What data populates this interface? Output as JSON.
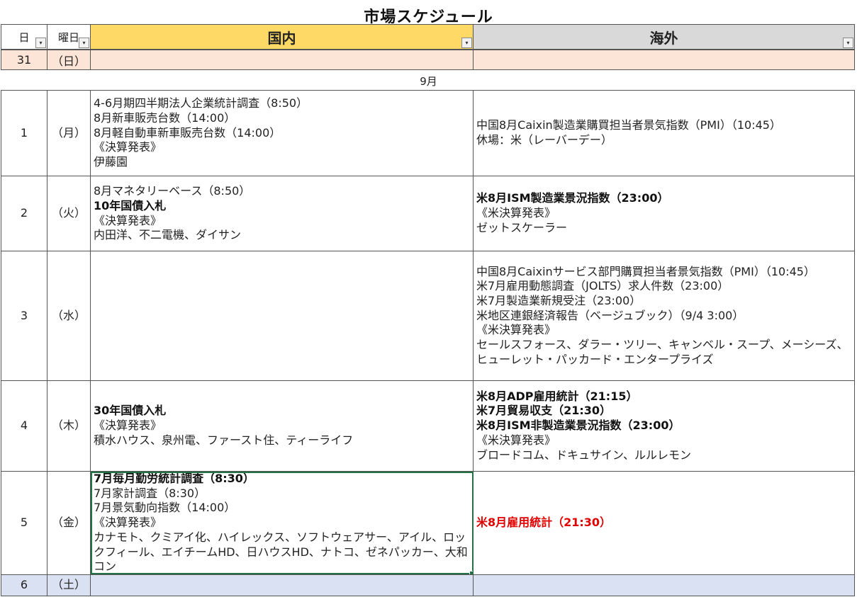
{
  "title": "市場スケジュール",
  "header": {
    "day": "日",
    "weekday": "曜日",
    "domestic": "国内",
    "overseas": "海外",
    "filter_glyph": "▾"
  },
  "row31": {
    "day": "31",
    "weekday": "（日）",
    "domestic": "",
    "overseas": ""
  },
  "month_label": "9月",
  "rows": [
    {
      "day": "1",
      "weekday": "（月）",
      "domestic": [
        "4-6月期四半期法人企業統計調査（8:50）",
        "8月新車販売台数（14:00）",
        "8月軽自動車新車販売台数（14:00）",
        "《決算発表》",
        "伊藤園"
      ],
      "overseas": [
        "中国8月Caixin製造業購買担当者景気指数（PMI）（10:45）",
        "休場：米（レーバーデー）"
      ]
    },
    {
      "day": "2",
      "weekday": "（火）",
      "domestic": [
        "8月マネタリーベース（8:50）",
        "10年国債入札",
        "《決算発表》",
        "内田洋、不二電機、ダイサン"
      ],
      "overseas": [
        "米8月ISM製造業景況指数（23:00）",
        "《米決算発表》",
        "ゼットスケーラー"
      ]
    },
    {
      "day": "3",
      "weekday": "（水）",
      "domestic": [],
      "overseas": [
        "中国8月Caixinサービス部門購買担当者景気指数（PMI）（10:45）",
        "米7月雇用動態調査（JOLTS）求人件数（23:00）",
        "米7月製造業新規受注（23:00）",
        "米地区連銀経済報告（ベージュブック）（9/4 3:00）",
        "《米決算発表》",
        "セールスフォース、ダラー・ツリー、キャンベル・スープ、メーシーズ、ヒューレット・パッカード・エンタープライズ"
      ]
    },
    {
      "day": "4",
      "weekday": "（木）",
      "domestic": [
        "30年国債入札",
        "《決算発表》",
        "積水ハウス、泉州電、ファースト住、ティーライフ"
      ],
      "overseas": [
        "米8月ADP雇用統計（21:15）",
        "米7月貿易収支（21:30）",
        "米8月ISM非製造業景況指数（23:00）",
        "《米決算発表》",
        "ブロードコム、ドキュサイン、ルルレモン"
      ]
    },
    {
      "day": "5",
      "weekday": "（金）",
      "domestic": [
        "7月毎月勤労統計調査（8:30）",
        "7月家計調査（8:30）",
        "7月景気動向指数（14:00）",
        "《決算発表》",
        "カナモト、クミアイ化、ハイレックス、ソフトウェアサー、アイル、ロックフィール、エイチームHD、日ハウスHD、ナトコ、ゼネパッカー、大和コン"
      ],
      "overseas": [
        "米8月雇用統計（21:30）"
      ]
    },
    {
      "day": "6",
      "weekday": "（土）",
      "domestic": [],
      "overseas": []
    }
  ],
  "colors": {
    "domestic_header": "#ffd966",
    "overseas_header": "#d9d9d9",
    "sunday_row": "#fce4d6",
    "saturday_row": "#d9e1f2",
    "highlight_red": "#e00000",
    "selection": "#217346"
  }
}
